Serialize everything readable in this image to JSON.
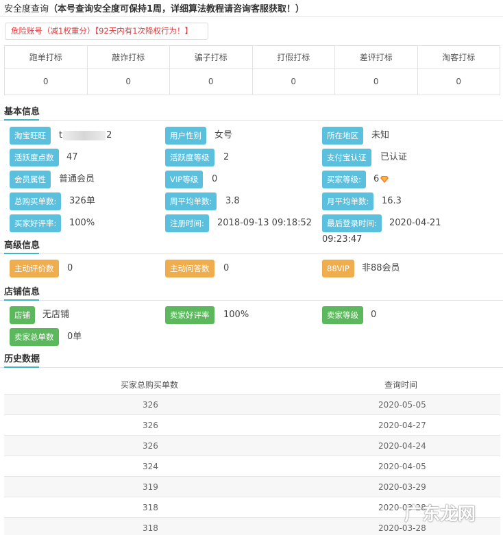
{
  "header": {
    "title": "安全度查询",
    "subtitle": "（本号查询安全度可保持1周，详细算法教程请咨询客服获取！）",
    "danger": "危险账号（减1权重分）【92天内有1次降权行为！】"
  },
  "flags": {
    "headers": [
      "跑单打标",
      "敲诈打标",
      "骗子打标",
      "打假打标",
      "差评打标",
      "淘客打标"
    ],
    "values": [
      "0",
      "0",
      "0",
      "0",
      "0",
      "0"
    ]
  },
  "basic": {
    "title": "基本信息",
    "taobao_label": "淘宝旺旺",
    "taobao_prefix": "t",
    "taobao_suffix": "2",
    "gender_label": "用户性别",
    "gender_value": "女号",
    "region_label": "所在地区",
    "region_value": "未知",
    "activity_points_label": "活跃度点数",
    "activity_points_value": "47",
    "activity_level_label": "活跃度等级",
    "activity_level_value": "2",
    "alipay_label": "支付宝认证",
    "alipay_value": "已认证",
    "member_label": "会员属性",
    "member_value": "普通会员",
    "vip_label": "VIP等级",
    "vip_value": "0",
    "buyer_level_label": "买家等级:",
    "buyer_level_value": "6",
    "total_orders_label": "总购买单数:",
    "total_orders_value": "326单",
    "weekly_label": "周平均单数:",
    "weekly_value": "3.8",
    "monthly_label": "月平均单数:",
    "monthly_value": "16.3",
    "buyer_rate_label": "买家好评率:",
    "buyer_rate_value": "100%",
    "register_label": "注册时间:",
    "register_value": "2018-09-13 09:18:52",
    "last_login_label": "最后登录时间:",
    "last_login_value_1": "2020-04-21",
    "last_login_value_2": "09:23:47"
  },
  "advanced": {
    "title": "高级信息",
    "active_review_label": "主动评价数",
    "active_review_value": "0",
    "active_question_label": "主动问答数",
    "active_question_value": "0",
    "vip88_label": "88VIP",
    "vip88_value": "非88会员"
  },
  "shop": {
    "title": "店铺信息",
    "shop_label": "店铺",
    "shop_value": "无店铺",
    "seller_rate_label": "卖家好评率",
    "seller_rate_value": "100%",
    "seller_level_label": "卖家等级",
    "seller_level_value": "0",
    "seller_orders_label": "卖家总单数",
    "seller_orders_value": "0单"
  },
  "history": {
    "title": "历史数据",
    "col_orders": "买家总购买单数",
    "col_time": "查询时间",
    "rows": [
      {
        "orders": "326",
        "date": "2020-05-05"
      },
      {
        "orders": "326",
        "date": "2020-04-27"
      },
      {
        "orders": "326",
        "date": "2020-04-24"
      },
      {
        "orders": "324",
        "date": "2020-04-05"
      },
      {
        "orders": "319",
        "date": "2020-03-29"
      },
      {
        "orders": "318",
        "date": "2020-03-28"
      },
      {
        "orders": "318",
        "date": "2020-03-28"
      }
    ]
  },
  "watermark": "广东龙网",
  "colors": {
    "blue_tag": "#5bc0de",
    "orange_tag": "#f0ad4e",
    "green_tag": "#5cb85c",
    "danger": "#e4393c",
    "accent": "#3fb5c0"
  }
}
